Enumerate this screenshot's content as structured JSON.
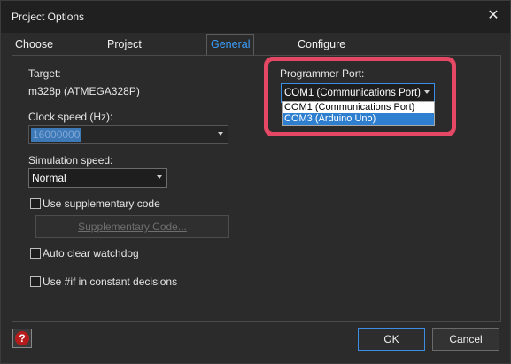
{
  "window": {
    "title": "Project Options",
    "close_icon": "close-icon"
  },
  "tabs": [
    {
      "label": "Choose a Target",
      "active": false
    },
    {
      "label": "Project description",
      "active": false
    },
    {
      "label": "General Options",
      "active": true
    },
    {
      "label": "Configure",
      "active": false
    }
  ],
  "general": {
    "target_label": "Target:",
    "target_value": "m328p (ATMEGA328P)",
    "clock_label": "Clock speed (Hz):",
    "clock_value": "16000000",
    "sim_label": "Simulation speed:",
    "sim_value": "Normal",
    "use_supp_label": "Use supplementary code",
    "supp_button": "Supplementary Code...",
    "auto_watchdog_label": "Auto clear watchdog",
    "use_if_label": "Use #if in constant decisions"
  },
  "programmer": {
    "label": "Programmer Port:",
    "selected": "COM1 (Communications Port)",
    "options": [
      "COM1 (Communications Port)",
      "COM3 (Arduino Uno)"
    ],
    "highlighted_index": 1,
    "highlight_color": "#e54865"
  },
  "footer": {
    "ok": "OK",
    "cancel": "Cancel",
    "help_icon": "help-icon"
  },
  "colors": {
    "accent": "#3aa0ff",
    "selection": "#2f7fd1",
    "callout": "#e54865"
  }
}
